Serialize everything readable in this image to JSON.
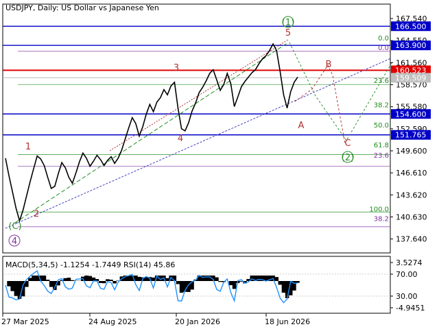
{
  "chart_data": [
    {
      "type": "line",
      "title": "USDJPY, Daily:  US Dollar vs Japanese Yen",
      "ylim": [
        135.75,
        169.5
      ],
      "y_ticks": [
        "167.540",
        "164.550",
        "161.560",
        "158.570",
        "155.580",
        "152.590",
        "149.600",
        "146.610",
        "143.620",
        "140.630",
        "137.640"
      ],
      "x_ticks": [
        "27 Mar 2025",
        "24 Aug 2025",
        "20 Jan 2026",
        "18 Jun 2026"
      ],
      "series": [
        {
          "values": [
            148.6,
            146.2,
            144.0,
            141.8,
            140.1,
            141.6,
            143.5,
            145.4,
            147.2,
            148.9,
            148.5,
            147.6,
            146.0,
            144.5,
            144.8,
            146.5,
            148.0,
            147.3,
            146.0,
            145.2,
            146.6,
            148.1,
            149.3,
            148.6,
            147.5,
            148.2,
            149.0,
            148.4,
            147.6,
            148.3,
            148.8,
            147.9,
            148.6,
            149.7,
            151.2,
            152.7,
            154.1,
            153.3,
            151.6,
            152.9,
            154.6,
            155.9,
            154.9,
            156.2,
            156.8,
            157.9,
            157.2,
            158.4,
            158.9,
            155.4,
            152.6,
            152.3,
            153.4,
            155.0,
            156.1,
            157.5,
            158.2,
            159.1,
            160.1,
            160.6,
            159.2,
            157.8,
            158.6,
            160.1,
            158.7,
            155.6,
            156.9,
            158.3,
            159.0,
            159.6,
            160.2,
            160.6,
            161.4,
            162.1,
            162.5,
            163.2,
            164.1,
            163.2,
            160.4,
            157.2,
            155.4,
            157.6,
            158.9,
            159.6
          ]
        }
      ],
      "horizontal_levels": [
        {
          "label": "166.500",
          "value": 166.5,
          "color": "#0000c8"
        },
        {
          "label": "163.900",
          "value": 163.9,
          "color": "#0000c8"
        },
        {
          "label": "160.523",
          "value": 160.523,
          "color": "#e00000"
        },
        {
          "label": "159.509",
          "value": 159.509,
          "color": "#c0c0c0"
        },
        {
          "label": "154.600",
          "value": 154.6,
          "color": "#0000c8"
        },
        {
          "label": "151.765",
          "value": 151.765,
          "color": "#0000c8"
        }
      ],
      "fibonacci_labels": [
        {
          "label": "0.0",
          "value": 164.4,
          "color": "#1e8c1e"
        },
        {
          "label": "0.0",
          "value": 163.1,
          "color": "#8030a0"
        },
        {
          "label": "23.6",
          "value": 158.6,
          "color": "#1e8c1e"
        },
        {
          "label": "38.2",
          "value": 155.3,
          "color": "#1e8c1e"
        },
        {
          "label": "50.0",
          "value": 152.6,
          "color": "#1e8c1e"
        },
        {
          "label": "61.8",
          "value": 149.9,
          "color": "#1e8c1e"
        },
        {
          "label": "23.6",
          "value": 148.5,
          "color": "#8030a0"
        },
        {
          "label": "100.0",
          "value": 141.2,
          "color": "#1e8c1e"
        },
        {
          "label": "38.2",
          "value": 139.9,
          "color": "#8030a0"
        }
      ],
      "wave_labels": [
        "(1)",
        "5",
        "3",
        "4",
        "1",
        "2",
        "(C)",
        "4",
        "A",
        "B",
        "C",
        "(2)"
      ],
      "grid": false
    },
    {
      "type": "bar",
      "title": "MACD(5,34,5) -1.1254 -1.7449 RSI(14) 45.86",
      "y_ticks": [
        "3.5274",
        "70.00",
        "30.00",
        "-4.9451"
      ],
      "indicators": [
        "MACD",
        "RSI"
      ],
      "grid": false
    }
  ],
  "colors": {
    "background": "#ffffff",
    "price": "#000000",
    "blue_level": "#0000c8",
    "red_level": "#e00000",
    "fib_green": "#1e8c1e",
    "fib_purple": "#8030a0",
    "forecast_green": "#2d8f2d",
    "forecast_red": "#b03030",
    "rsi": "#1e90ff"
  }
}
